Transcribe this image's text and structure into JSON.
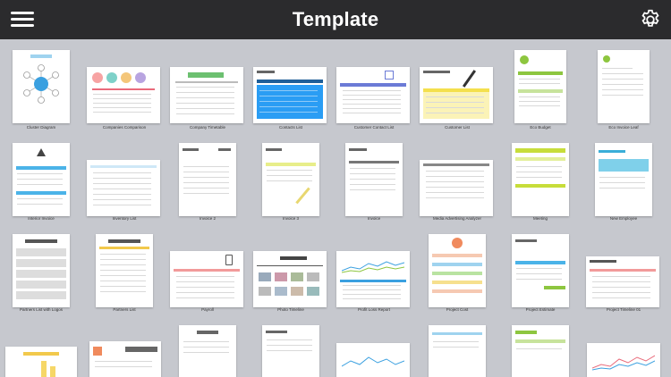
{
  "header": {
    "title": "Template"
  },
  "colors": {
    "topbar": "#2b2b2d",
    "background": "#c6c8ce",
    "accent_blue": "#3aa0e0",
    "accent_green": "#8dc63f",
    "accent_yellow": "#f4e04d"
  },
  "templates": [
    {
      "label": "Cluster Diagram"
    },
    {
      "label": "Companies Comparison"
    },
    {
      "label": "Company Timetable"
    },
    {
      "label": "Contacts List"
    },
    {
      "label": "Customer Contact List"
    },
    {
      "label": "Customer List"
    },
    {
      "label": "Eco Budget"
    },
    {
      "label": "Eco Invoice Leaf"
    },
    {
      "label": "Interior Invoice"
    },
    {
      "label": "Inventory List"
    },
    {
      "label": "Invoice 2"
    },
    {
      "label": "Invoice 3"
    },
    {
      "label": "Invoice"
    },
    {
      "label": "Media Advertising Analyzer"
    },
    {
      "label": "Meeting"
    },
    {
      "label": "New Employee"
    },
    {
      "label": "Partners List with Logos"
    },
    {
      "label": "Partners List"
    },
    {
      "label": "Payroll"
    },
    {
      "label": "Photo Timeline"
    },
    {
      "label": "Profit Loss Report"
    },
    {
      "label": "Project Cost"
    },
    {
      "label": "Project Estimate"
    },
    {
      "label": "Project Timeline 01"
    }
  ]
}
